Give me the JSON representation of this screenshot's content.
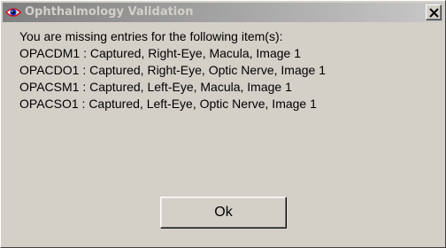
{
  "window": {
    "title": "Ophthalmology Validation",
    "title_icon": "eye-app-icon",
    "close_icon": "close-icon"
  },
  "message": {
    "intro": "You are missing entries for the following item(s):",
    "items": [
      "OPACDM1 : Captured, Right-Eye, Macula, Image 1",
      "OPACDO1 : Captured, Right-Eye, Optic Nerve, Image 1",
      "OPACSM1 : Captured, Left-Eye, Macula, Image 1",
      "OPACSO1 : Captured, Left-Eye, Optic Nerve, Image 1"
    ]
  },
  "buttons": {
    "ok_label": "Ok"
  },
  "colors": {
    "dialog_face": "#d4d0c8",
    "titlebar_inactive_start": "#808080",
    "titlebar_inactive_end": "#c8c8c8",
    "title_text": "#d4d0c8",
    "icon_red": "#cc2020",
    "icon_blue": "#1030c0"
  }
}
